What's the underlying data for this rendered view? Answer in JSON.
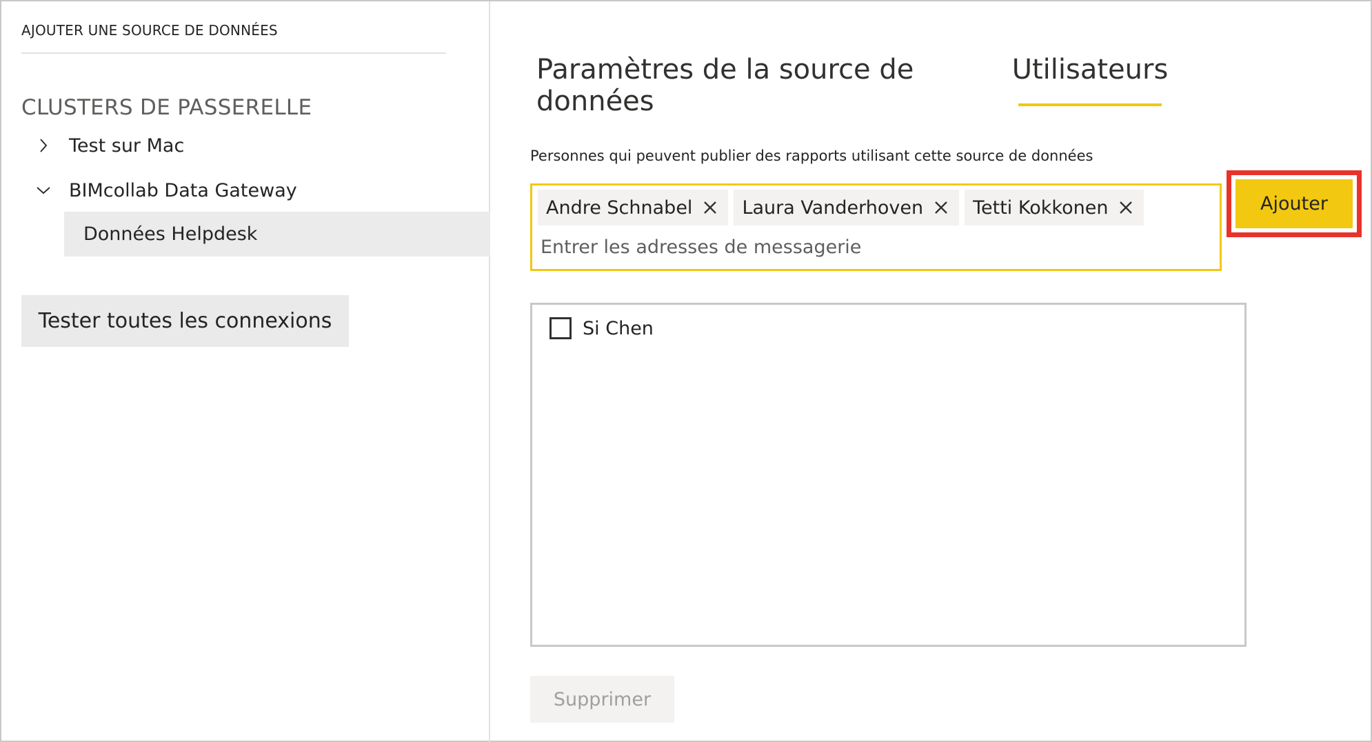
{
  "left_pane": {
    "add_source_label": "AJOUTER UNE SOURCE DE DONNÉES",
    "clusters_heading": "CLUSTERS DE PASSERELLE",
    "clusters": [
      {
        "label": "Test sur Mac",
        "expanded": false,
        "icon": "chevron-right-icon"
      },
      {
        "label": "BIMcollab Data Gateway",
        "expanded": true,
        "icon": "chevron-down-icon",
        "datasources": [
          {
            "label": "Données Helpdesk",
            "selected": true
          }
        ]
      }
    ],
    "test_all_label": "Tester toutes les connexions"
  },
  "tabs": [
    {
      "label": "Paramètres de la source de données",
      "active": false
    },
    {
      "label": "Utilisateurs",
      "active": true
    }
  ],
  "users_panel": {
    "description": "Personnes qui peuvent publier des rapports utilisant cette source de données",
    "chips": [
      {
        "label": "Andre Schnabel",
        "icon": "close-icon"
      },
      {
        "label": "Laura Vanderhoven",
        "icon": "close-icon"
      },
      {
        "label": "Tetti Kokkonen",
        "icon": "close-icon"
      }
    ],
    "email_placeholder": "Entrer les adresses de messagerie",
    "add_label": "Ajouter",
    "users": [
      {
        "name": "Si Chen",
        "checked": false
      }
    ],
    "delete_label": "Supprimer"
  },
  "colors": {
    "accent": "#f2c811",
    "highlight": "#e8322a",
    "selected_bg": "#ebebeb",
    "button_bg": "#eaeaea",
    "disabled_text": "#a19f9d"
  }
}
